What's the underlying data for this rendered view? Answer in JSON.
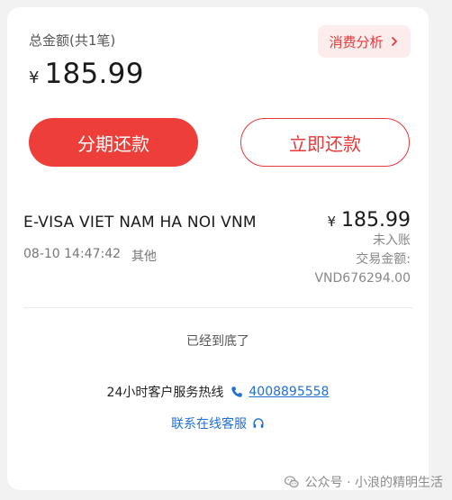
{
  "summary": {
    "total_label": "总金额(共1笔)",
    "currency_symbol": "¥",
    "total_amount": "185.99",
    "analysis_label": "消费分析"
  },
  "actions": {
    "installment_label": "分期还款",
    "repay_now_label": "立即还款"
  },
  "transaction": {
    "merchant": "E-VISA VIET NAM HA NOI VNM",
    "datetime": "08-10 14:47:42",
    "category": "其他",
    "currency_symbol": "¥",
    "amount": "185.99",
    "status": "未入账",
    "txn_amount_label": "交易金额:",
    "txn_amount_value": "VND676294.00"
  },
  "footer": {
    "end_text": "已经到底了",
    "hotline_label": "24小时客户服务热线",
    "hotline_number": "4008895558",
    "online_service_label": "联系在线客服"
  },
  "watermark": {
    "text": "公众号 · 小浪的精明生活"
  },
  "colors": {
    "accent": "#ed3e3a",
    "link": "#1f6fd6",
    "analysis_bg": "#fdecec"
  },
  "icons": {
    "analysis": "chevron-right-icon",
    "hotline": "phone-icon",
    "online": "headset-icon",
    "watermark": "wechat-icon"
  }
}
